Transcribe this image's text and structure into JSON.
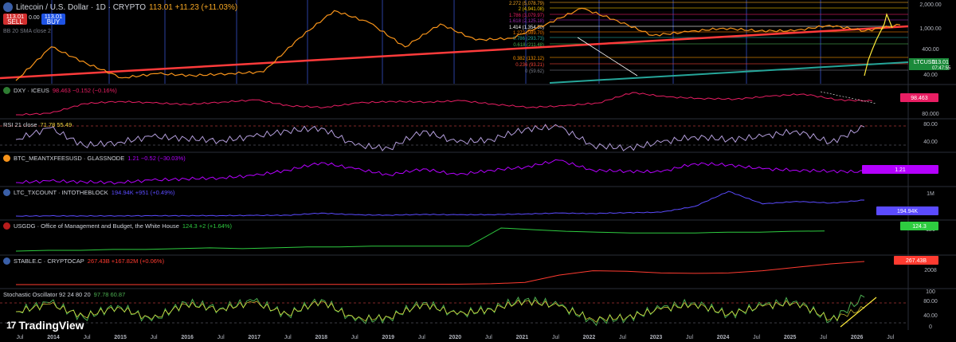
{
  "header": {
    "symbol": "Litecoin / U.S. Dollar · 1D · CRYPTO",
    "price": "113.01",
    "change": "113.01 +11.23 (+11.03%)",
    "sell_price": "113.01",
    "sell_label": "SELL",
    "spread": "0.00",
    "buy_price": "113.01",
    "buy_label": "BUY",
    "bb_label": "BB 20 SMA close 2"
  },
  "brand": {
    "mark": "17",
    "name": "TradingView"
  },
  "colors": {
    "price": "#f7931a",
    "trend_red": "#ff3b3b",
    "trend_teal": "#26a69a",
    "dxy": "#e91e63",
    "rsi": "#b39ddb",
    "fees": "#b400ff",
    "tx": "#5b4bff",
    "usgdg": "#2ecc40",
    "stable": "#ff3b30",
    "stoch": "#4caf50",
    "stoch_d": "#ffeb3b"
  },
  "chart_data": [
    {
      "type": "line",
      "title": "Litecoin / U.S. Dollar · 1D · CRYPTO",
      "series": [
        {
          "name": "LTCUSD",
          "last": 113.01,
          "x": [
            "2013-07",
            "2014-01",
            "2014-07",
            "2015-01",
            "2015-07",
            "2016-01",
            "2016-07",
            "2017-01",
            "2017-07",
            "2017-12",
            "2018-04",
            "2018-12",
            "2019-06",
            "2019-12",
            "2020-06",
            "2020-12",
            "2021-05",
            "2021-12",
            "2022-06",
            "2022-12",
            "2023-06",
            "2023-12",
            "2024-06",
            "2024-12",
            "2025-04",
            "2025-07"
          ],
          "values": [
            2.5,
            25,
            8,
            3,
            4,
            3.5,
            4,
            4.5,
            45,
            300,
            130,
            25,
            120,
            40,
            45,
            120,
            350,
            150,
            55,
            70,
            90,
            75,
            75,
            110,
            75,
            113.01
          ]
        }
      ],
      "fib_levels": [
        {
          "ratio": "2.272",
          "value": "(5,078.79)"
        },
        {
          "ratio": "2",
          "value": "(4,941.08)"
        },
        {
          "ratio": "1.786",
          "value": "(3,079.97)"
        },
        {
          "ratio": "1.618",
          "value": "(2,125.18)"
        },
        {
          "ratio": "1.414",
          "value": "(1,354.30)"
        },
        {
          "ratio": "1.272",
          "value": "(989.70)"
        },
        {
          "ratio": "0.786",
          "value": "(293.73)"
        },
        {
          "ratio": "0.618",
          "value": "(211.48)"
        },
        {
          "ratio": "0.382",
          "value": "(132.12)"
        },
        {
          "ratio": "0.236",
          "value": "(93.21)"
        },
        {
          "ratio": "0",
          "value": "(59.62)"
        }
      ],
      "axis_ticks": [
        "2,000.00",
        "1,000.00",
        "400.00",
        "40.00"
      ],
      "price_label": "LTCUSD",
      "price_value": "113.01",
      "countdown": "07:47:55",
      "log_scale": true
    },
    {
      "type": "line",
      "title": "DXY · ICEUS",
      "header_values": "98.463 −0.152 (−0.16%)",
      "series": [
        {
          "name": "DXY",
          "values": [
            80,
            82,
            95,
            98,
            96,
            94,
            97,
            100,
            92,
            90,
            96,
            98,
            97,
            99,
            94,
            90,
            92,
            96,
            110,
            104,
            102,
            101,
            105,
            108,
            100,
            98.463
          ]
        }
      ],
      "axis_ticks": [
        "80.000"
      ],
      "last_label": "98.463"
    },
    {
      "type": "line",
      "title": "RSI 21 close",
      "header_values": "71.78 55.49",
      "series": [
        {
          "name": "RSI",
          "values": [
            50,
            70,
            40,
            45,
            55,
            52,
            48,
            55,
            65,
            70,
            40,
            35,
            65,
            45,
            50,
            68,
            72,
            40,
            35,
            45,
            55,
            50,
            55,
            65,
            45,
            71.78
          ]
        }
      ],
      "axis_ticks": [
        "80.00",
        "40.00"
      ]
    },
    {
      "type": "line",
      "title": "BTC_MEANTXFEESUSD · GLASSNODE",
      "header_values": "1.21 −0.52 (−30.03%)",
      "series": [
        {
          "name": "BTC_MEANTXFEESUSD",
          "values": [
            0.05,
            0.08,
            0.06,
            0.05,
            0.1,
            0.15,
            0.2,
            0.4,
            2,
            20,
            3,
            0.5,
            3,
            0.5,
            2,
            5,
            40,
            2,
            1.5,
            1.2,
            15,
            10,
            3,
            2,
            1.5,
            1.21
          ]
        }
      ],
      "last_label": "1.21"
    },
    {
      "type": "line",
      "title": "LTC_TXCOUNT · INTOTHEBLOCK",
      "header_values": "194.94K +951 (+0.49%)",
      "series": [
        {
          "name": "LTC_TXCOUNT",
          "values": [
            5,
            6,
            6,
            7,
            8,
            9,
            10,
            12,
            15,
            40,
            20,
            15,
            25,
            20,
            22,
            30,
            40,
            35,
            45,
            50,
            120,
            300,
            150,
            180,
            160,
            194.94
          ]
        }
      ],
      "axis_ticks": [
        "1M",
        "0"
      ],
      "last_label": "194.94K"
    },
    {
      "type": "line",
      "title": "USGDG · Office of Management and Budget, the White House",
      "header_values": "124.3 +2 (+1.64%)",
      "series": [
        {
          "name": "USGDG",
          "values": [
            100,
            101,
            101,
            102,
            102,
            103,
            104,
            103,
            104,
            105,
            105,
            106,
            106,
            106,
            106,
            128,
            126,
            124,
            123,
            122,
            122,
            122,
            123,
            123,
            124,
            124.3
          ]
        }
      ],
      "axis_ticks": [
        "120"
      ],
      "last_label": "124.3"
    },
    {
      "type": "line",
      "title": "STABLE.C · CRYPTOCAP",
      "header_values": "267.43B +167.82M (+0.06%)",
      "series": [
        {
          "name": "STABLE.C",
          "values": [
            0,
            0,
            0,
            0,
            0,
            0,
            0,
            0,
            1,
            2,
            3,
            3,
            4,
            5,
            10,
            25,
            110,
            160,
            155,
            135,
            130,
            135,
            160,
            200,
            240,
            267.43
          ]
        }
      ],
      "axis_ticks": [
        "2008"
      ],
      "last_label": "267.43B"
    },
    {
      "type": "line",
      "title": "Stochastic Oscillator 92 24 80 20",
      "header_values": "97.78 60.87",
      "series": [
        {
          "name": "%K",
          "values": [
            50,
            80,
            30,
            70,
            20,
            80,
            60,
            85,
            40,
            90,
            20,
            30,
            80,
            40,
            60,
            90,
            70,
            20,
            30,
            60,
            80,
            40,
            70,
            85,
            20,
            97.78
          ]
        },
        {
          "name": "%D",
          "values": [
            50,
            75,
            35,
            65,
            25,
            75,
            58,
            80,
            42,
            85,
            25,
            32,
            75,
            42,
            58,
            85,
            68,
            25,
            32,
            58,
            75,
            42,
            68,
            80,
            25,
            60.87
          ]
        }
      ],
      "axis_ticks": [
        "100",
        "80.00",
        "40.00",
        "0"
      ]
    }
  ],
  "x_axis": [
    "Jul",
    "2014",
    "Jul",
    "2015",
    "Jul",
    "2016",
    "Jul",
    "2017",
    "Jul",
    "2018",
    "Jul",
    "2019",
    "Jul",
    "2020",
    "Jul",
    "2021",
    "Jul",
    "2022",
    "Jul",
    "2023",
    "Jul",
    "2024",
    "Jul",
    "2025",
    "Jul",
    "2026",
    "Jul"
  ]
}
